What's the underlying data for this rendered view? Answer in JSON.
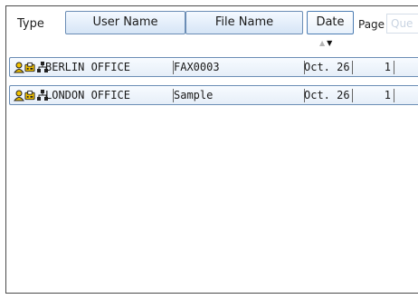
{
  "header": {
    "type_label": "Type",
    "user_name_label": "User Name",
    "file_name_label": "File Name",
    "date_label": "Date",
    "page_label": "Page",
    "queue_label": "Que"
  },
  "sort": {
    "column": "Date",
    "direction": "descending"
  },
  "jobs": [
    {
      "type_icons": [
        "user-icon",
        "fax-icon",
        "network-icon"
      ],
      "user_name": "BERLIN OFFICE",
      "file_name": "FAX0003",
      "date": "Oct. 26",
      "page": "1"
    },
    {
      "type_icons": [
        "user-icon",
        "fax-icon",
        "network-icon"
      ],
      "user_name": "LONDON OFFICE",
      "file_name": "Sample",
      "date": "Oct. 26",
      "page": "1"
    }
  ],
  "colors": {
    "header_border": "#6b8db5",
    "row_fill": "#e6eef8",
    "icon_yellow": "#f2c200"
  }
}
